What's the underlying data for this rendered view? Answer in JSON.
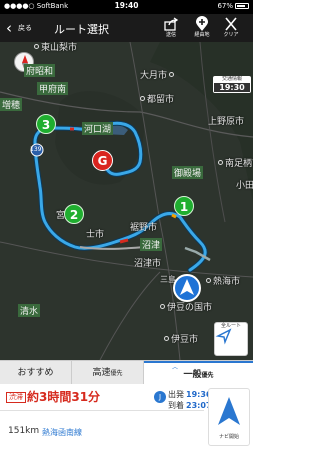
{
  "status_bar": {
    "carrier": "SoftBank",
    "time": "19:40",
    "battery": "67%"
  },
  "nav": {
    "back_label": "戻る",
    "title": "ルート選択",
    "actions": [
      {
        "icon": "share-icon",
        "label": "送信"
      },
      {
        "icon": "add-waypoint-icon",
        "label": "経由地"
      },
      {
        "icon": "close-icon",
        "label": "クリア"
      }
    ]
  },
  "map": {
    "traffic_info": {
      "label": "交通情報",
      "time": "19:30"
    },
    "cities": [
      "東山梨市",
      "大月市",
      "府昭和",
      "甲府南",
      "都留市",
      "増穂",
      "上野原市",
      "河口湖",
      "南足柄市",
      "御殿場",
      "小田",
      "宮市",
      "士市",
      "裾野市",
      "沼津",
      "沼津市",
      "三島",
      "熱海市",
      "伊豆の国市",
      "伊豆市",
      "清水"
    ],
    "route_number": "139",
    "goal_label": "G",
    "waypoints": [
      "1",
      "2",
      "3"
    ],
    "all_route_label": "全ルート"
  },
  "tabs": [
    {
      "label": "おすすめ",
      "suffix": ""
    },
    {
      "label": "高速",
      "suffix": "優先"
    },
    {
      "label": "一般",
      "suffix": "優先"
    }
  ],
  "summary": {
    "badge": "渋滞",
    "duration": "約3時間31分",
    "depart_label": "出発",
    "depart_time": "19:36",
    "arrive_label": "到着",
    "arrive_time": "23:07",
    "distance": "151km",
    "road": "熱海函南線",
    "nav_start_label": "ナビ開始"
  },
  "colors": {
    "route": "#3aa8e8",
    "accent": "#2a77d0",
    "jam": "#d62a1e",
    "waypoint": "#1fae2f",
    "goal": "#d9241f",
    "map_bg": "#2d342d"
  }
}
